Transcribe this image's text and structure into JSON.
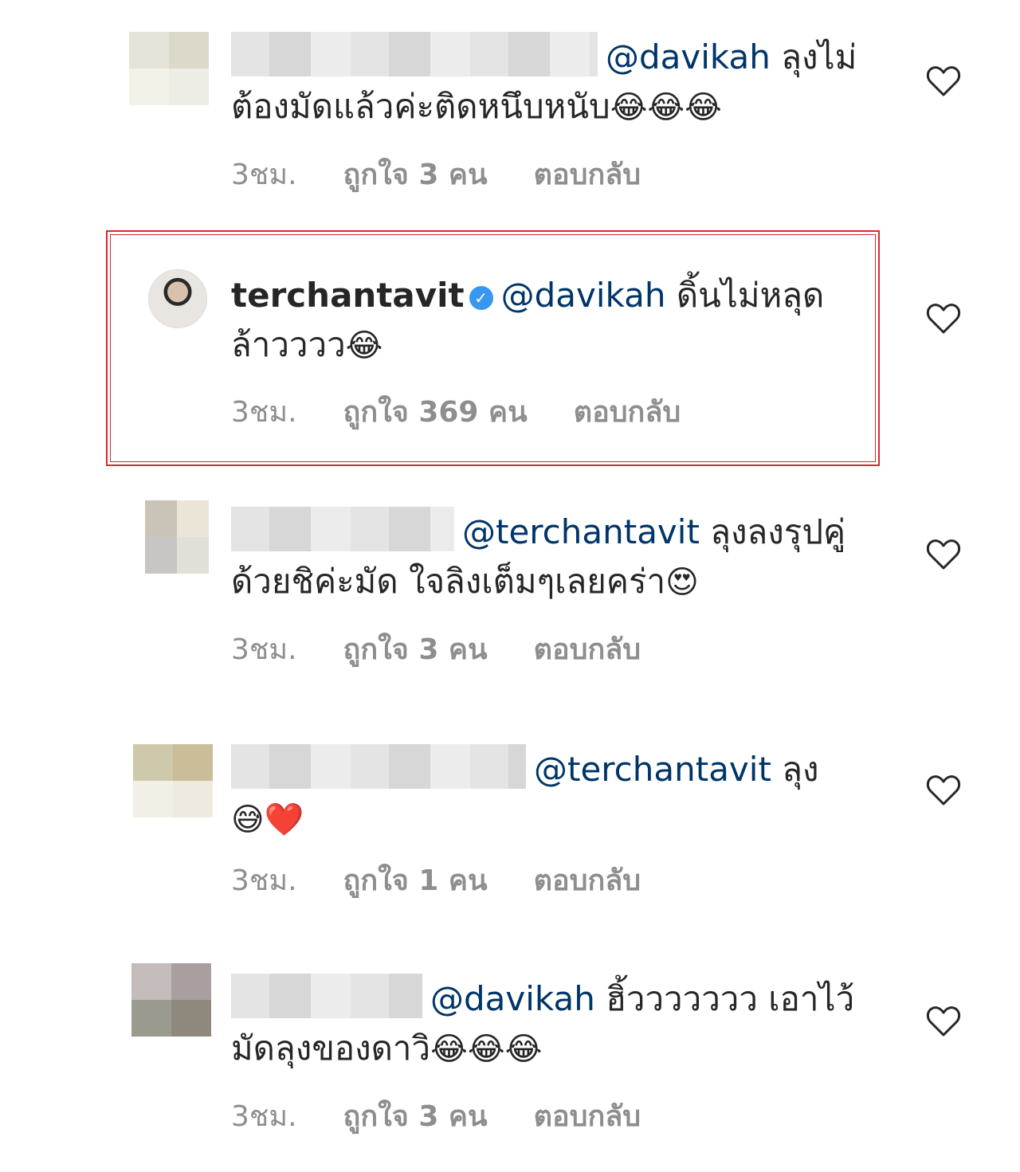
{
  "comments": [
    {
      "username": "",
      "verified": false,
      "mention": "@davikah",
      "text": " ลุงไม่ต้องมัดแล้วค่ะติดหนึบหนับ",
      "emojis": "😂😂😂",
      "time": "3ชม.",
      "likes": "ถูกใจ 3 คน",
      "reply": "ตอบกลับ"
    },
    {
      "username": "terchantavit",
      "verified": true,
      "mention": "@davikah",
      "text": " ดิ้นไม่หลุดล้าวววว",
      "emojis": "😂",
      "time": "3ชม.",
      "likes": "ถูกใจ 369 คน",
      "reply": "ตอบกลับ",
      "highlighted": true
    },
    {
      "username": "",
      "verified": false,
      "mention": "@terchantavit",
      "text": " ลุงลงรุปคู่ด้วยชิค่ะมัด ใจลิงเต็มๆเลยคร่า",
      "emojis": "😍",
      "time": "3ชม.",
      "likes": "ถูกใจ 3 คน",
      "reply": "ตอบกลับ"
    },
    {
      "username": "",
      "verified": false,
      "mention": "@terchantavit",
      "text": " ลุง",
      "emojis": "😅❤️",
      "time": "3ชม.",
      "likes": "ถูกใจ 1 คน",
      "reply": "ตอบกลับ"
    },
    {
      "username": "",
      "verified": false,
      "mention": "@davikah",
      "text": " ฮิ้ววววววว เอาไว้มัดลุงของดาวิ",
      "emojis": "😂😂😂",
      "time": "3ชม.",
      "likes": "ถูกใจ 3 คน",
      "reply": "ตอบกลับ"
    }
  ],
  "colors": {
    "mention": "#003569",
    "meta": "#8e8e8e",
    "highlight_border": "#d62b2b",
    "verified": "#3897f0"
  },
  "icons": {
    "like": "heart-outline-icon",
    "verified": "verified-badge-icon"
  }
}
